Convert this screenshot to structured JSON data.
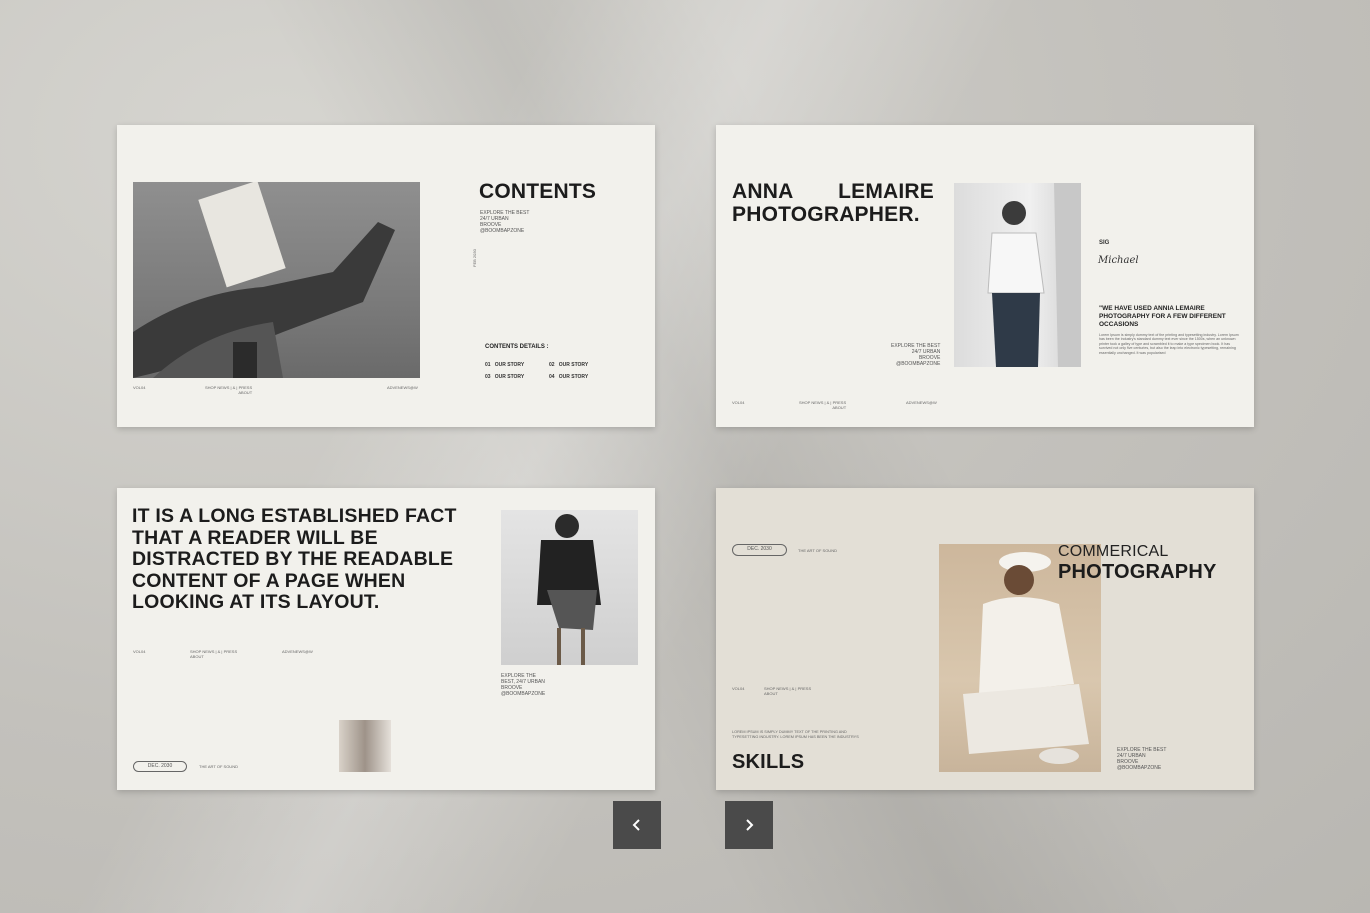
{
  "slide1": {
    "title": "CONTENTS",
    "tagline": [
      "EXPLORE THE BEST",
      "24/7 URBAN",
      "BROOVE",
      "@BOOMBAPZONE"
    ],
    "vertical_date": "FEB 2030",
    "details_heading": "CONTENTS DETAILS :",
    "items": [
      {
        "num": "01",
        "label": "OUR STORY"
      },
      {
        "num": "02",
        "label": "OUR STORY"
      },
      {
        "num": "03",
        "label": "OUR STORY"
      },
      {
        "num": "04",
        "label": "OUR STORY"
      }
    ],
    "footer_left": "VOL04",
    "footer_mid": "SHOP NEWS | & | PRESS",
    "footer_mid2": "ABOUT",
    "footer_right": "ADVENEWS@W"
  },
  "slide2": {
    "title_line1_a": "ANNA",
    "title_line1_b": "LEMAIRE",
    "title_line2": "PHOTOGRAPHER.",
    "sig_label": "SIG",
    "signature": "Michael",
    "quote": "\"WE HAVE USED ANNIA LEMAIRE PHOTOGRAPHY FOR A FEW DIFFERENT OCCASIONS",
    "body": "Lorem Ipsum is simply dummy text of the printing and typesetting industry. Lorem Ipsum has been the industry's standard dummy text ever since the 1500s, when an unknown printer took a galley of type and scrambled it to make a type specimen book. It has survived not only five centuries, but also the leap into electronic typesetting, remaining essentially unchanged. It was popularised",
    "tagline": [
      "EXPLORE THE BEST",
      "24/7 URBAN",
      "BROOVE",
      "@BOOMBAPZONE"
    ],
    "footer_left": "VOL04",
    "footer_mid": "SHOP NEWS | & | PRESS",
    "footer_mid2": "ABOUT",
    "footer_right": "ADVENEWS@W"
  },
  "slide3": {
    "headline": "IT IS A LONG ESTABLISHED FACT THAT A READER WILL BE DISTRACTED BY THE READABLE CONTENT OF A PAGE WHEN LOOKING AT ITS LAYOUT.",
    "footer_left": "VOL04",
    "footer_mid": "SHOP NEWS | & | PRESS",
    "footer_mid2": "ABOUT",
    "footer_right": "ADVENEWS@W",
    "tagline": [
      "EXPLORE THE",
      "BEST, 24/7 URBAN",
      "BROOVE",
      "@BOOMBAPZONE"
    ],
    "pill": "DEC. 2030",
    "pill_note": "THE ART OF SOUND"
  },
  "slide4": {
    "pill": "DEC. 2030",
    "pill_note": "THE ART OF SOUND",
    "title_line1": "COMMERICAL",
    "title_line2": "PHOTOGRAPHY",
    "footer_left": "VOL04",
    "footer_mid": "SHOP NEWS | & | PRESS",
    "footer_mid2": "ABOUT",
    "body": "LOREM IPSUM IS SIMPLY DUMMY TEXT OF THE PRINTING AND TYPESETTING INDUSTRY. LOREM IPSUM HAS BEEN THE INDUSTRYS",
    "skills": "SKILLS",
    "tagline": [
      "EXPLORE THE BEST",
      "24/7 URBAN",
      "BROOVE",
      "@BOOMBAPZONE"
    ]
  },
  "nav": {
    "prev_icon": "chevron-left-icon",
    "next_icon": "chevron-right-icon"
  }
}
